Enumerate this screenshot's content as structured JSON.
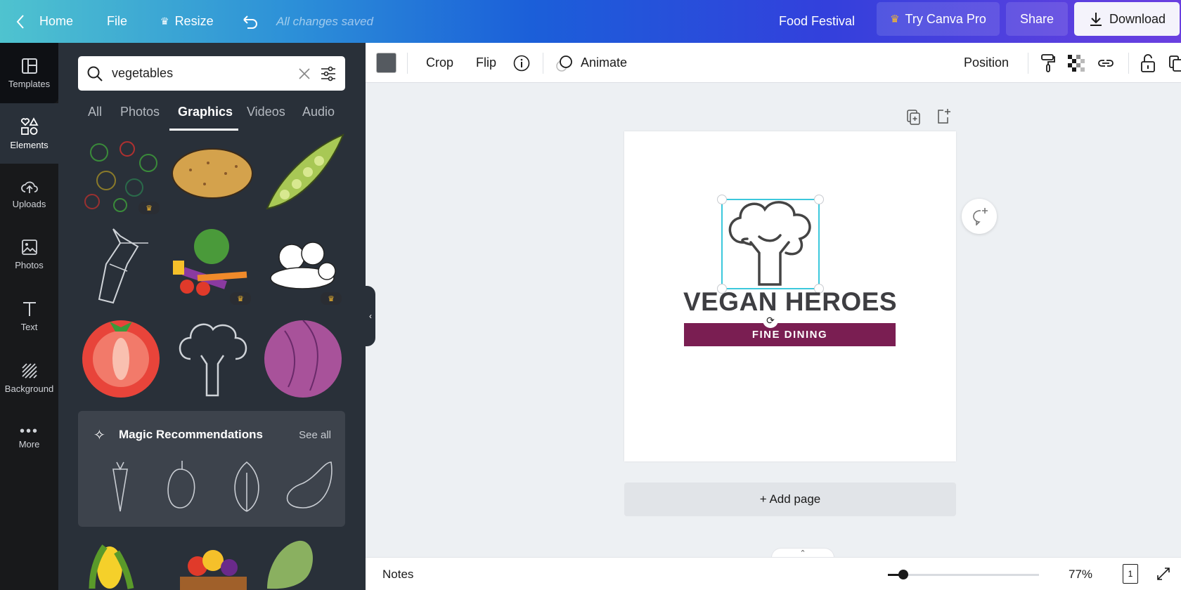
{
  "header": {
    "home": "Home",
    "file": "File",
    "resize": "Resize",
    "status": "All changes saved",
    "design_title": "Food Festival",
    "try_pro": "Try Canva Pro",
    "share": "Share",
    "download": "Download"
  },
  "rail": [
    {
      "label": "Templates",
      "icon": "templates-icon"
    },
    {
      "label": "Elements",
      "icon": "elements-icon"
    },
    {
      "label": "Uploads",
      "icon": "upload-icon"
    },
    {
      "label": "Photos",
      "icon": "photos-icon"
    },
    {
      "label": "Text",
      "icon": "text-icon"
    },
    {
      "label": "Background",
      "icon": "background-icon"
    },
    {
      "label": "More",
      "icon": "more-icon"
    }
  ],
  "search": {
    "value": "vegetables"
  },
  "tabs": [
    "All",
    "Photos",
    "Graphics",
    "Videos",
    "Audio"
  ],
  "active_tab": "Graphics",
  "magic": {
    "title": "Magic Recommendations",
    "see_all": "See all"
  },
  "toolbar": {
    "color": "#555a60",
    "crop": "Crop",
    "flip": "Flip",
    "animate": "Animate",
    "position": "Position"
  },
  "canvas": {
    "heading": "VEGAN HEROES",
    "subheading": "FINE DINING",
    "banner_color": "#7a1e52",
    "add_page": "+ Add page"
  },
  "footer": {
    "notes": "Notes",
    "zoom": "77%",
    "zoom_fraction": 0.1,
    "page_count": "1"
  }
}
